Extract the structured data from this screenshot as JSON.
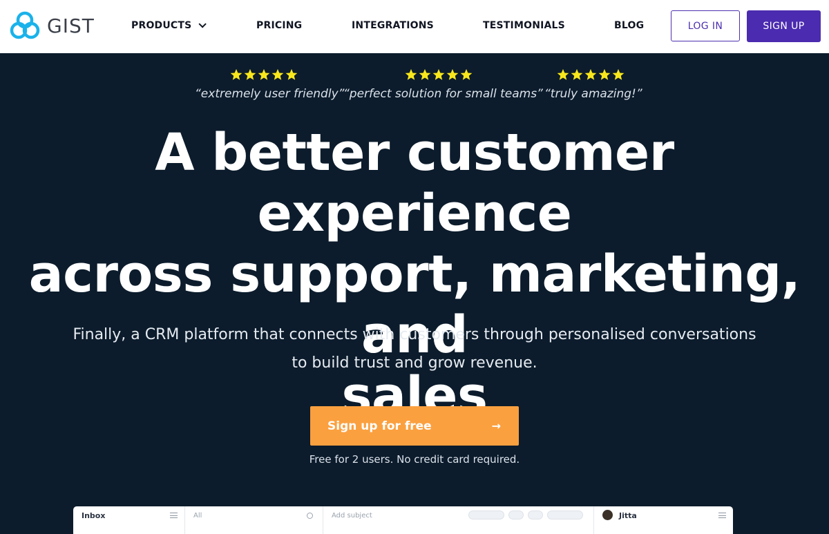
{
  "brand": {
    "name": "GIST",
    "logo_icon": "gist-rings-logo",
    "logo_color": "#1ab2ea"
  },
  "nav": {
    "products": "PRODUCTS",
    "pricing": "PRICING",
    "integrations": "INTEGRATIONS",
    "testimonials": "TESTIMONIALS",
    "blog": "BLOG",
    "login": "LOG IN",
    "signup": "SIGN UP"
  },
  "reviews": [
    {
      "rating": 5,
      "quote": "“extremely user friendly”"
    },
    {
      "rating": 5,
      "quote": "“perfect solution for small teams”"
    },
    {
      "rating": 5,
      "quote": "“truly amazing!”"
    }
  ],
  "hero": {
    "headline_line1": "A better customer experience",
    "headline_line2": "across support, marketing, and",
    "headline_line3": "sales",
    "subhead_line1": "Finally, a CRM platform that connects with customers through personalised conversations",
    "subhead_line2": "to build trust and grow revenue.",
    "cta_label": "Sign up for free",
    "cta_arrow": "→",
    "cta_note": "Free for 2 users. No credit card required."
  },
  "app_preview": {
    "inbox_label": "Inbox",
    "list_filter": "All",
    "main_placeholder": "Add subject",
    "side_name": "Jitta"
  },
  "colors": {
    "hero_background": "#0c1c2c",
    "accent_purple": "#4b2bb0",
    "cta_orange": "#fba03f",
    "star_yellow": "#f8e71c"
  }
}
